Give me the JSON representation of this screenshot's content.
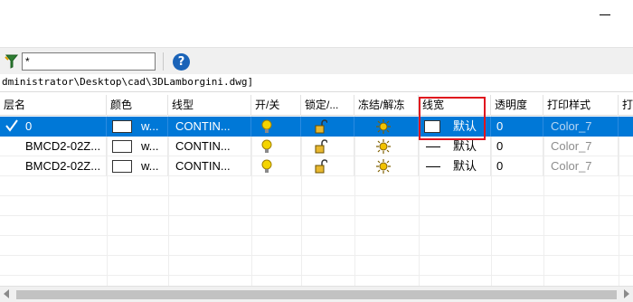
{
  "toolbar": {
    "filter_value": "*",
    "help_label": "?"
  },
  "path_text": "dministrator\\Desktop\\cad\\3DLamborgini.dwg]",
  "columns": [
    "层名",
    "颜色",
    "线型",
    "开/关",
    "锁定/...",
    "冻结/解冻",
    "线宽",
    "透明度",
    "打印样式",
    "打"
  ],
  "rows": [
    {
      "name": "0",
      "color": "w...",
      "linetype": "CONTIN...",
      "lineweight": "默认",
      "transparency": "0",
      "plot_style": "Color_7",
      "selected": true
    },
    {
      "name": "BMCD2-02Z...",
      "color": "w...",
      "linetype": "CONTIN...",
      "lineweight": "默认",
      "transparency": "0",
      "plot_style": "Color_7",
      "selected": false
    },
    {
      "name": "BMCD2-02Z...",
      "color": "w...",
      "linetype": "CONTIN...",
      "lineweight": "默认",
      "transparency": "0",
      "plot_style": "Color_7",
      "selected": false
    }
  ],
  "colors": {
    "selection": "#0078d7",
    "annotation_box": "#e0141e",
    "bulb": "#f5d400",
    "sun": "#f2c200"
  },
  "icons": [
    "filter-icon",
    "help-icon",
    "checkmark-icon",
    "lightbulb-icon",
    "lock-open-icon",
    "sun-icon",
    "plot-icon"
  ]
}
